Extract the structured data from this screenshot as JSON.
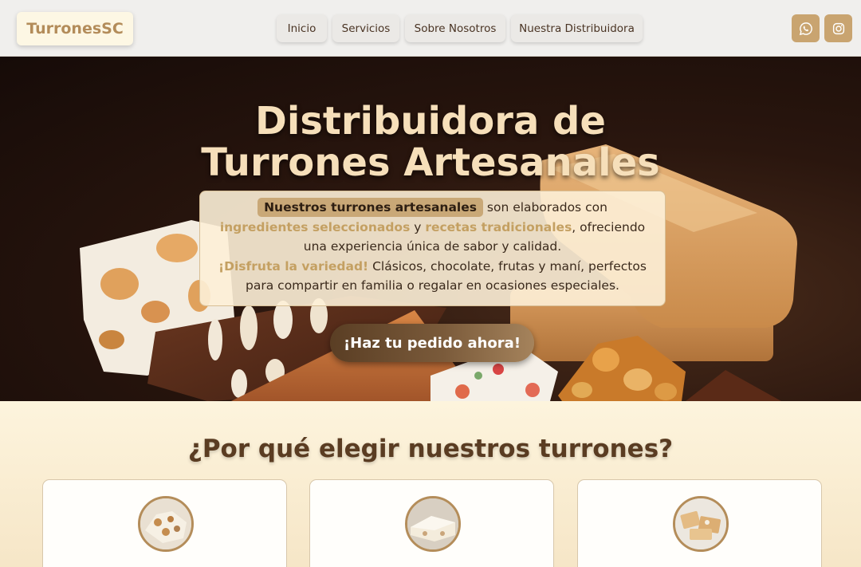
{
  "navbar": {
    "brand": "TurronesSC",
    "links": [
      "Inicio",
      "Servicios",
      "Sobre Nosotros",
      "Nuestra Distribuidora"
    ],
    "social": [
      {
        "icon": "whatsapp-icon"
      },
      {
        "icon": "instagram-icon"
      }
    ]
  },
  "hero": {
    "title_line1": "Distribuidora de",
    "title_line2": "Turrones Artesanales",
    "desc": {
      "highlight": "Nuestros turrones artesanales",
      "t1": " son elaborados con ",
      "gold1": "ingredientes seleccionados",
      "t2": " y ",
      "gold2": "recetas tradicionales",
      "t3": ", ofreciendo una experiencia única de sabor y calidad.",
      "gold3": "¡Disfruta la variedad!",
      "t4": " Clásicos, chocolate, frutas y maní, perfectos para compartir en familia o regalar en ocasiones especiales."
    },
    "cta": "¡Haz tu pedido ahora!"
  },
  "why": {
    "title": "¿Por qué elegir nuestros turrones?"
  },
  "colors": {
    "accent": "#c9a470",
    "title": "#f6dfba",
    "brand": "#b38c5a"
  }
}
